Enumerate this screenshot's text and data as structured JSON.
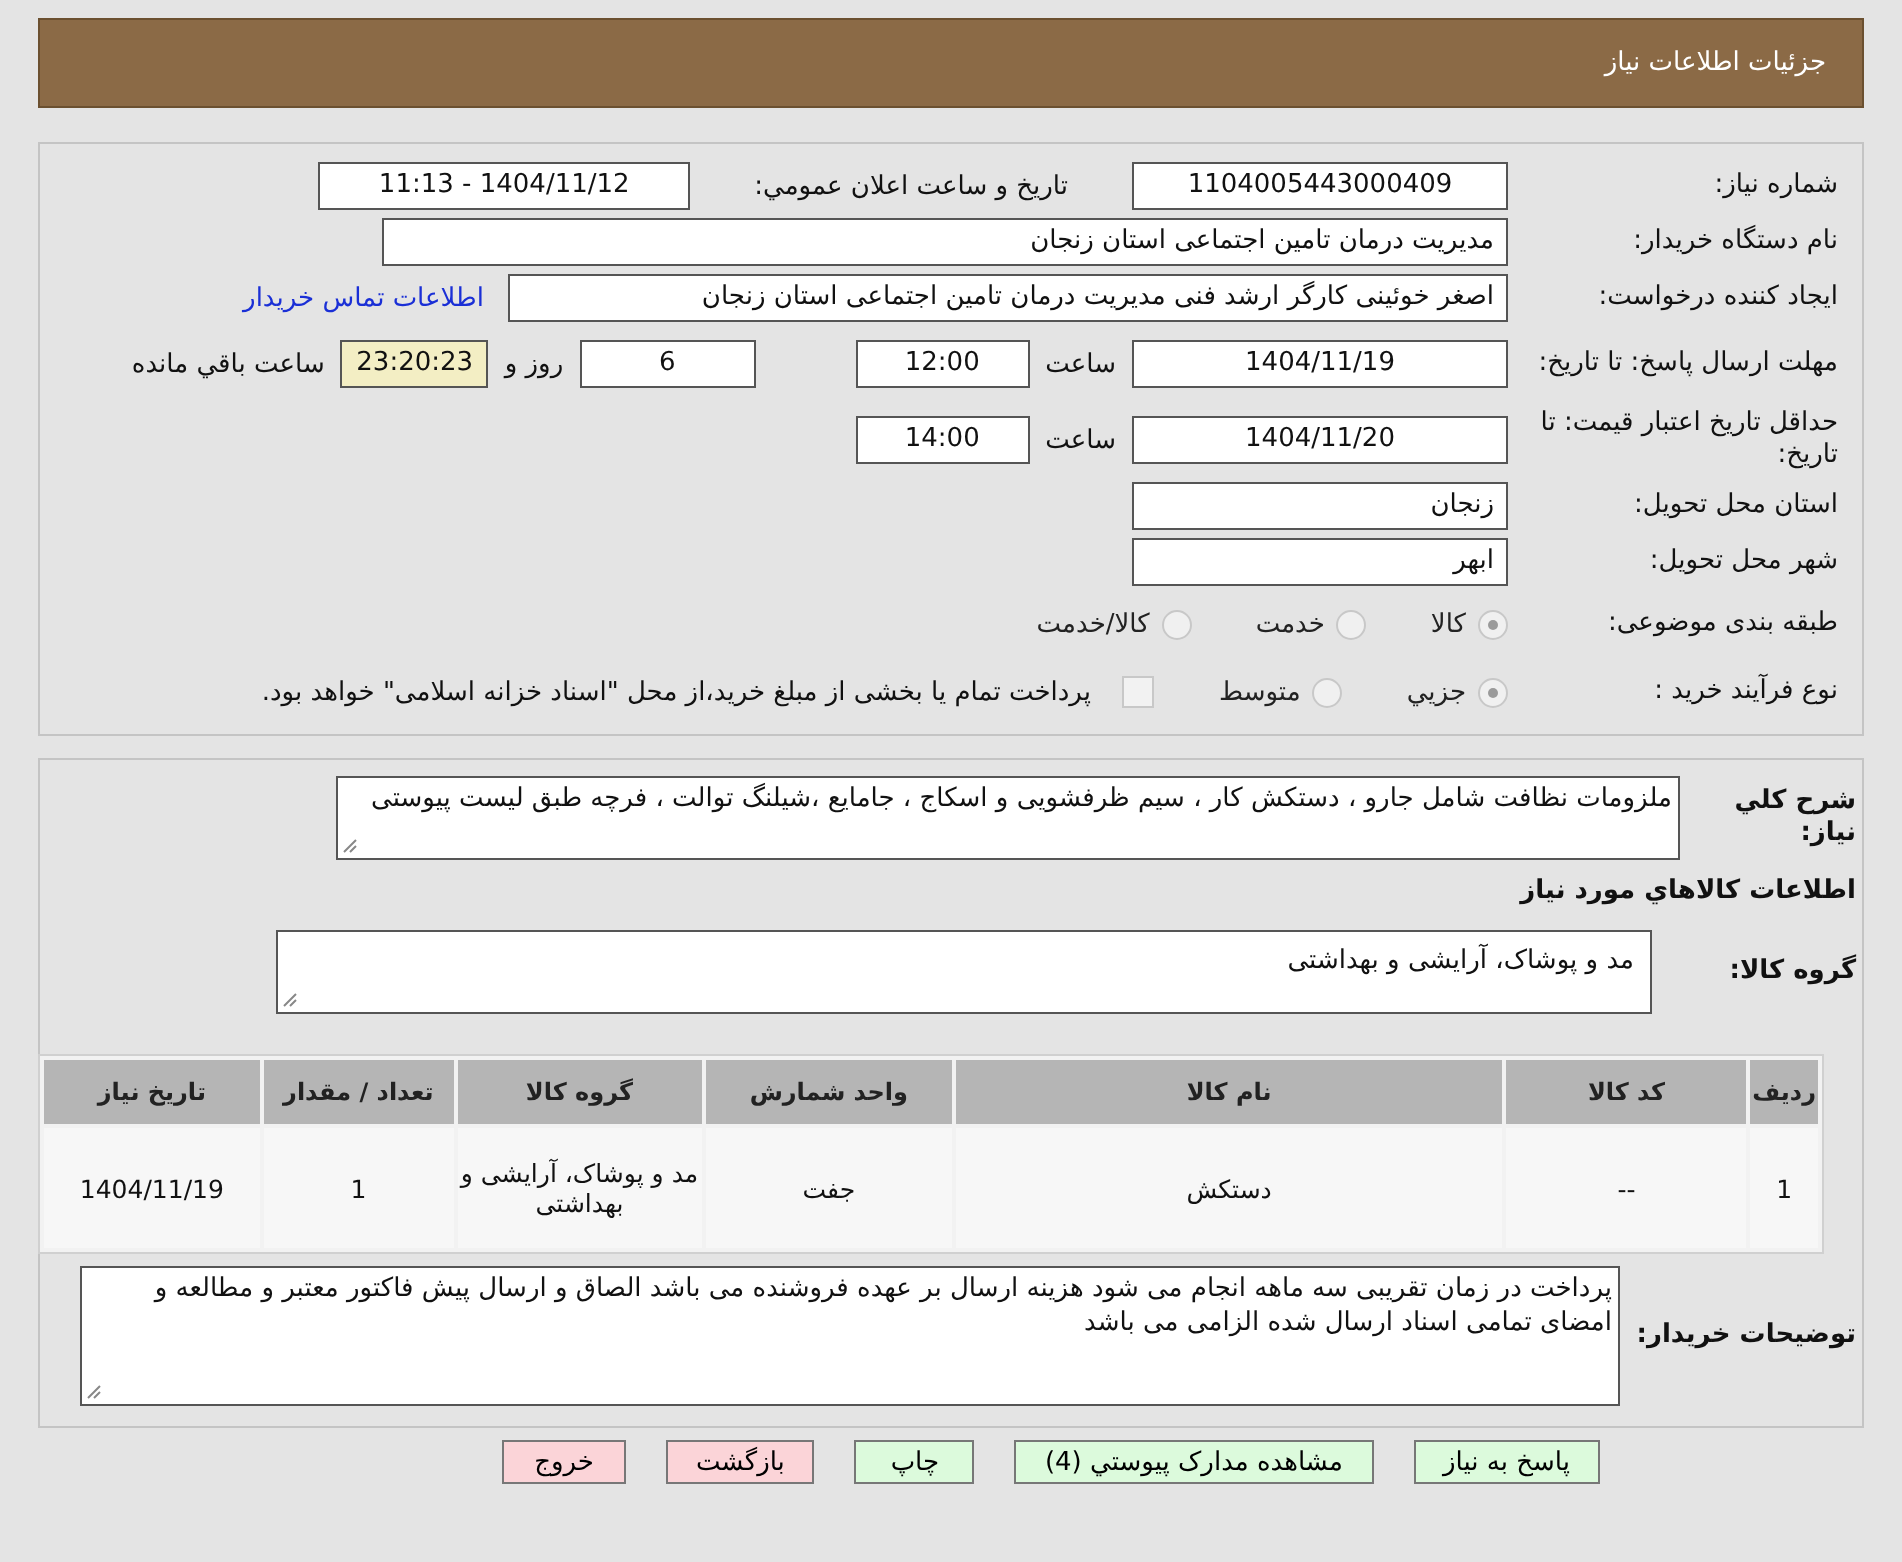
{
  "header": {
    "title": "جزئیات اطلاعات نیاز"
  },
  "details": {
    "need_number": {
      "label": "شماره نیاز:",
      "value": "1104005443000409"
    },
    "announce": {
      "label": "تاریخ و ساعت اعلان عمومي:",
      "value": "1404/11/12 - 11:13"
    },
    "buyer": {
      "label": "نام دستگاه خریدار:",
      "value": "مدیریت درمان تامین اجتماعی استان زنجان"
    },
    "creator": {
      "label": "ایجاد کننده درخواست:",
      "value": "اصغر خوئینی کارگر ارشد فنی مدیریت درمان تامین اجتماعی استان زنجان",
      "link": "اطلاعات تماس خریدار"
    },
    "deadline": {
      "label": "مهلت ارسال پاسخ: تا تاریخ:",
      "date": "1404/11/19",
      "time_label": "ساعت",
      "time": "12:00",
      "days": "6",
      "days_label": "روز و",
      "remaining": "23:20:23",
      "remaining_label": "ساعت باقي مانده"
    },
    "validity": {
      "label": "حداقل تاریخ اعتبار قیمت: تا تاریخ:",
      "date": "1404/11/20",
      "time_label": "ساعت",
      "time": "14:00"
    },
    "province": {
      "label": "استان محل تحویل:",
      "value": "زنجان"
    },
    "city": {
      "label": "شهر محل تحویل:",
      "value": "ابهر"
    },
    "category": {
      "label": "طبقه بندی موضوعی:",
      "options": [
        {
          "label": "کالا",
          "selected": true
        },
        {
          "label": "خدمت",
          "selected": false
        },
        {
          "label": "کالا/خدمت",
          "selected": false
        }
      ]
    },
    "process": {
      "label": "نوع فرآیند خرید :",
      "options": [
        {
          "label": "جزيي",
          "selected": true
        },
        {
          "label": "متوسط",
          "selected": false
        }
      ],
      "treasury": {
        "checked": false,
        "label": "پرداخت تمام یا بخشی از مبلغ خرید،از محل \"اسناد خزانه اسلامی\" خواهد بود."
      }
    }
  },
  "goods": {
    "description": {
      "label": "شرح کلي نیاز:",
      "value": "ملزومات نظافت شامل جارو ، دستکش کار ،  سیم ظرفشویی و اسکاج ، جامایع ،شیلنگ توالت ، فرچه طبق لیست پیوستی"
    },
    "heading": "اطلاعات کالاهاي مورد نیاز",
    "group": {
      "label": "گروه کالا:",
      "value": "مد و پوشاک، آرایشی و بهداشتی"
    },
    "table": {
      "columns": [
        "ردیف",
        "کد کالا",
        "نام کالا",
        "واحد شمارش",
        "گروه کالا",
        "تعداد / مقدار",
        "تاریخ نیاز"
      ],
      "rows": [
        [
          "1",
          "--",
          "دستکش",
          "جفت",
          "مد و پوشاک، آرایشی و بهداشتی",
          "1",
          "1404/11/19"
        ]
      ]
    },
    "buyer_notes": {
      "label": "توضیحات خریدار:",
      "value": "پرداخت در زمان تقریبی سه ماهه انجام می شود هزینه ارسال بر عهده فروشنده می باشد الصاق و ارسال پیش فاکتور معتبر و مطالعه و امضای تمامی اسناد ارسال شده الزامی می باشد"
    }
  },
  "buttons": [
    {
      "label": "پاسخ به نیاز",
      "kind": "primary"
    },
    {
      "label": "مشاهده مدارک پیوستي (4)",
      "kind": "primary"
    },
    {
      "label": "چاپ",
      "kind": "primary"
    },
    {
      "label": "بازگشت",
      "kind": "danger"
    },
    {
      "label": "خروج",
      "kind": "danger"
    }
  ]
}
